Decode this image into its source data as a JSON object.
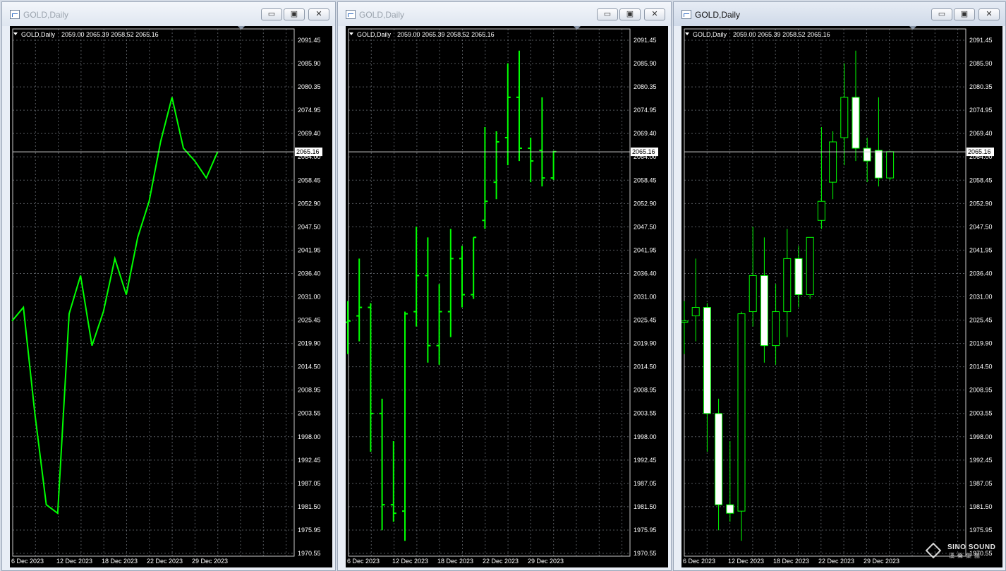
{
  "windows": [
    {
      "title": "GOLD,Daily",
      "style": "line",
      "active": false,
      "info_symbol": "GOLD,Daily",
      "info_ohlc": "2059.00 2065.39 2058.52 2065.16",
      "current_price": "2065.16",
      "controls": {
        "minimize": "▭",
        "restore": "▣",
        "close": "✕"
      }
    },
    {
      "title": "GOLD,Daily",
      "style": "bar",
      "active": false,
      "info_symbol": "GOLD,Daily",
      "info_ohlc": "2059.00 2065.39 2058.52 2065.16",
      "current_price": "2065.16",
      "controls": {
        "minimize": "▭",
        "restore": "▣",
        "close": "✕"
      }
    },
    {
      "title": "GOLD,Daily",
      "style": "candle",
      "active": true,
      "info_symbol": "GOLD,Daily",
      "info_ohlc": "2059.00 2065.39 2058.52 2065.16",
      "current_price": "2065.16",
      "controls": {
        "minimize": "▭",
        "restore": "▣",
        "close": "✕"
      }
    }
  ],
  "watermark": {
    "top": "SINO SOUND",
    "bottom": "漢聲集團"
  },
  "colors": {
    "background": "#000000",
    "line": "#00ff00",
    "grid": "#9aa0aa",
    "axis_text": "#ffffff",
    "bull_body": "#000000",
    "bear_body": "#ffffff"
  },
  "chart_data": {
    "type": "line",
    "title": "GOLD,Daily",
    "price_labels": [
      "2091.45",
      "2085.90",
      "2080.35",
      "2074.95",
      "2069.40",
      "2064.00",
      "2058.45",
      "2052.90",
      "2047.50",
      "2041.95",
      "2036.40",
      "2031.00",
      "2025.45",
      "2019.90",
      "2014.50",
      "2008.95",
      "2003.55",
      "1998.00",
      "1992.45",
      "1987.05",
      "1981.50",
      "1975.95",
      "1970.55"
    ],
    "date_labels": [
      "6 Dec 2023",
      "12 Dec 2023",
      "18 Dec 2023",
      "22 Dec 2023",
      "29 Dec 2023"
    ],
    "ylim": [
      1970.55,
      2091.45
    ],
    "bars": [
      {
        "o": 2025.0,
        "h": 2030.0,
        "l": 2017.5,
        "c": 2025.3
      },
      {
        "o": 2026.5,
        "h": 2040.0,
        "l": 2020.5,
        "c": 2028.5
      },
      {
        "o": 2028.5,
        "h": 2029.5,
        "l": 1994.5,
        "c": 2003.5
      },
      {
        "o": 2003.5,
        "h": 2007.0,
        "l": 1976.0,
        "c": 1982.0
      },
      {
        "o": 1982.0,
        "h": 1997.0,
        "l": 1978.0,
        "c": 1980.0
      },
      {
        "o": 1980.5,
        "h": 2027.5,
        "l": 1973.5,
        "c": 2027.0
      },
      {
        "o": 2027.5,
        "h": 2047.5,
        "l": 2024.0,
        "c": 2036.0
      },
      {
        "o": 2036.0,
        "h": 2045.0,
        "l": 2015.5,
        "c": 2019.5
      },
      {
        "o": 2019.5,
        "h": 2034.0,
        "l": 2015.0,
        "c": 2027.5
      },
      {
        "o": 2027.5,
        "h": 2047.0,
        "l": 2021.5,
        "c": 2040.0
      },
      {
        "o": 2040.0,
        "h": 2043.0,
        "l": 2028.5,
        "c": 2031.5
      },
      {
        "o": 2031.5,
        "h": 2045.0,
        "l": 2030.5,
        "c": 2045.0
      },
      {
        "o": 2049.0,
        "h": 2071.0,
        "l": 2047.0,
        "c": 2053.5
      },
      {
        "o": 2058.0,
        "h": 2070.0,
        "l": 2054.0,
        "c": 2067.5
      },
      {
        "o": 2068.5,
        "h": 2086.0,
        "l": 2062.0,
        "c": 2078.0
      },
      {
        "o": 2078.0,
        "h": 2089.0,
        "l": 2063.0,
        "c": 2066.0
      },
      {
        "o": 2066.0,
        "h": 2068.5,
        "l": 2058.0,
        "c": 2063.0
      },
      {
        "o": 2065.5,
        "h": 2078.0,
        "l": 2057.0,
        "c": 2059.0
      },
      {
        "o": 2059.0,
        "h": 2065.4,
        "l": 2058.5,
        "c": 2065.2
      }
    ]
  }
}
